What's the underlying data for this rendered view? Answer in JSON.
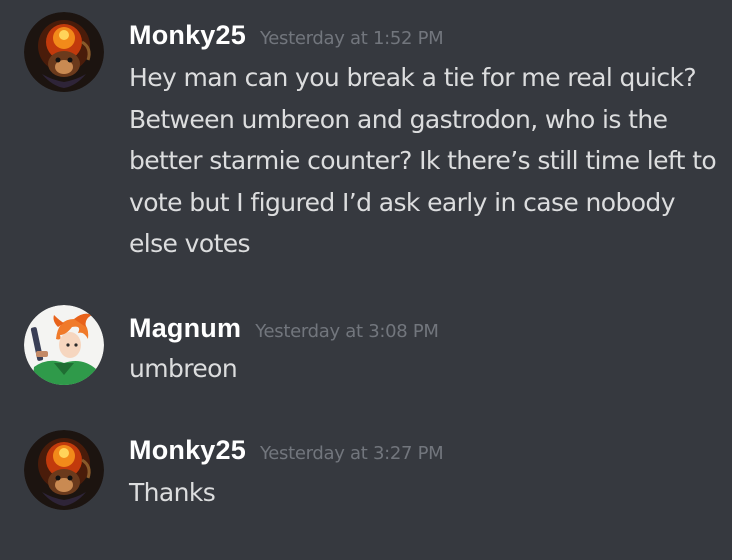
{
  "messages": [
    {
      "username": "Monky25",
      "timestamp": "Yesterday at 1:52 PM",
      "avatar_icon": "monkey-fire-avatar-icon",
      "text": "Hey man can you break a tie for me real quick? Between umbreon and gastrodon, who is the better starmie counter? Ik there’s still time left to vote but I figured I’d ask early in case nobody else votes"
    },
    {
      "username": "Magnum",
      "timestamp": "Yesterday at 3:08 PM",
      "avatar_icon": "orange-hair-character-avatar-icon",
      "text": "umbreon"
    },
    {
      "username": "Monky25",
      "timestamp": "Yesterday at 3:27 PM",
      "avatar_icon": "monkey-fire-avatar-icon",
      "text": "Thanks"
    }
  ],
  "colors": {
    "background": "#36393f",
    "username": "#ffffff",
    "timestamp": "#72767d",
    "text": "#dcddde"
  }
}
